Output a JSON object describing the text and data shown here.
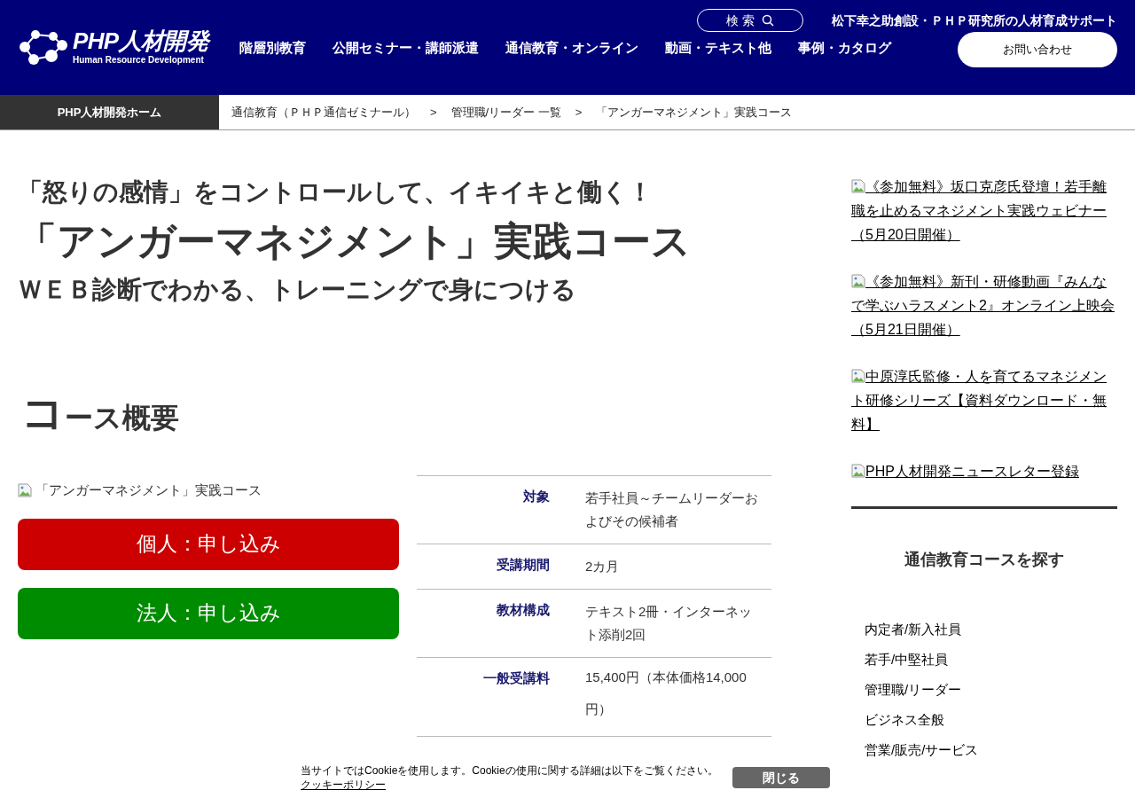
{
  "header": {
    "logo": {
      "name": "PHP人材開発",
      "tagline": "Human Resource Development"
    },
    "search_label": "検 索",
    "tagline": "松下幸之助創設・ＰＨＰ研究所の人材育成サポート",
    "nav": [
      "階層別教育",
      "公開セミナー・講師派遣",
      "通信教育・オンライン",
      "動画・テキスト他",
      "事例・カタログ"
    ],
    "contact_button": "お問い合わせ"
  },
  "breadcrumb": {
    "home": "PHP人材開発ホーム",
    "separator": ">",
    "items": [
      "通信教育（ＰＨＰ通信ゼミナール）",
      "管理職/リーダー 一覧",
      "「アンガーマネジメント」実践コース"
    ]
  },
  "title": {
    "lead": "「怒りの感情」をコントロールして、イキイキと働く！",
    "main": "「アンガーマネジメント」実践コース",
    "sub": "ＷＥＢ診断でわかる、トレーニングで身につける"
  },
  "overview": {
    "heading": "コース概要",
    "image_alt": "「アンガーマネジメント」実践コース",
    "buttons": [
      {
        "label": "個人：申し込み",
        "color": "#cc0000"
      },
      {
        "label": "法人：申し込み",
        "color": "#008c00"
      }
    ],
    "table": [
      {
        "label": "対象",
        "value": "若手社員～チームリーダーおよびその候補者"
      },
      {
        "label": "受講期間",
        "value": "2カ月"
      },
      {
        "label": "教材構成",
        "value": "テキスト2冊・インターネット添削2回"
      },
      {
        "label": "一般受講料",
        "value": "15,400円（本体価格14,000円）"
      }
    ]
  },
  "sidebar": {
    "banners": [
      "《参加無料》坂口克彦氏登壇！若手離職を止めるマネジメント実践ウェビナー（5月20日開催）",
      "《参加無料》新刊・研修動画『みんなで学ぶハラスメント2』オンライン上映会（5月21日開催）",
      "中原淳氏監修・人を育てるマネジメント研修シリーズ【資料ダウンロード・無料】",
      "PHP人材開発ニュースレター登録"
    ],
    "search_title": "通信教育コースを探す",
    "categories": [
      "内定者/新入社員",
      "若手/中堅社員",
      "管理職/リーダー",
      "ビジネス全般",
      "営業/販売/サービス"
    ]
  },
  "cookie_banner": {
    "text": "当サイトではCookieを使用します。Cookieの使用に関する詳細は以下をご覧ください。",
    "link": "クッキーポリシー",
    "close_button": "閉じる"
  }
}
